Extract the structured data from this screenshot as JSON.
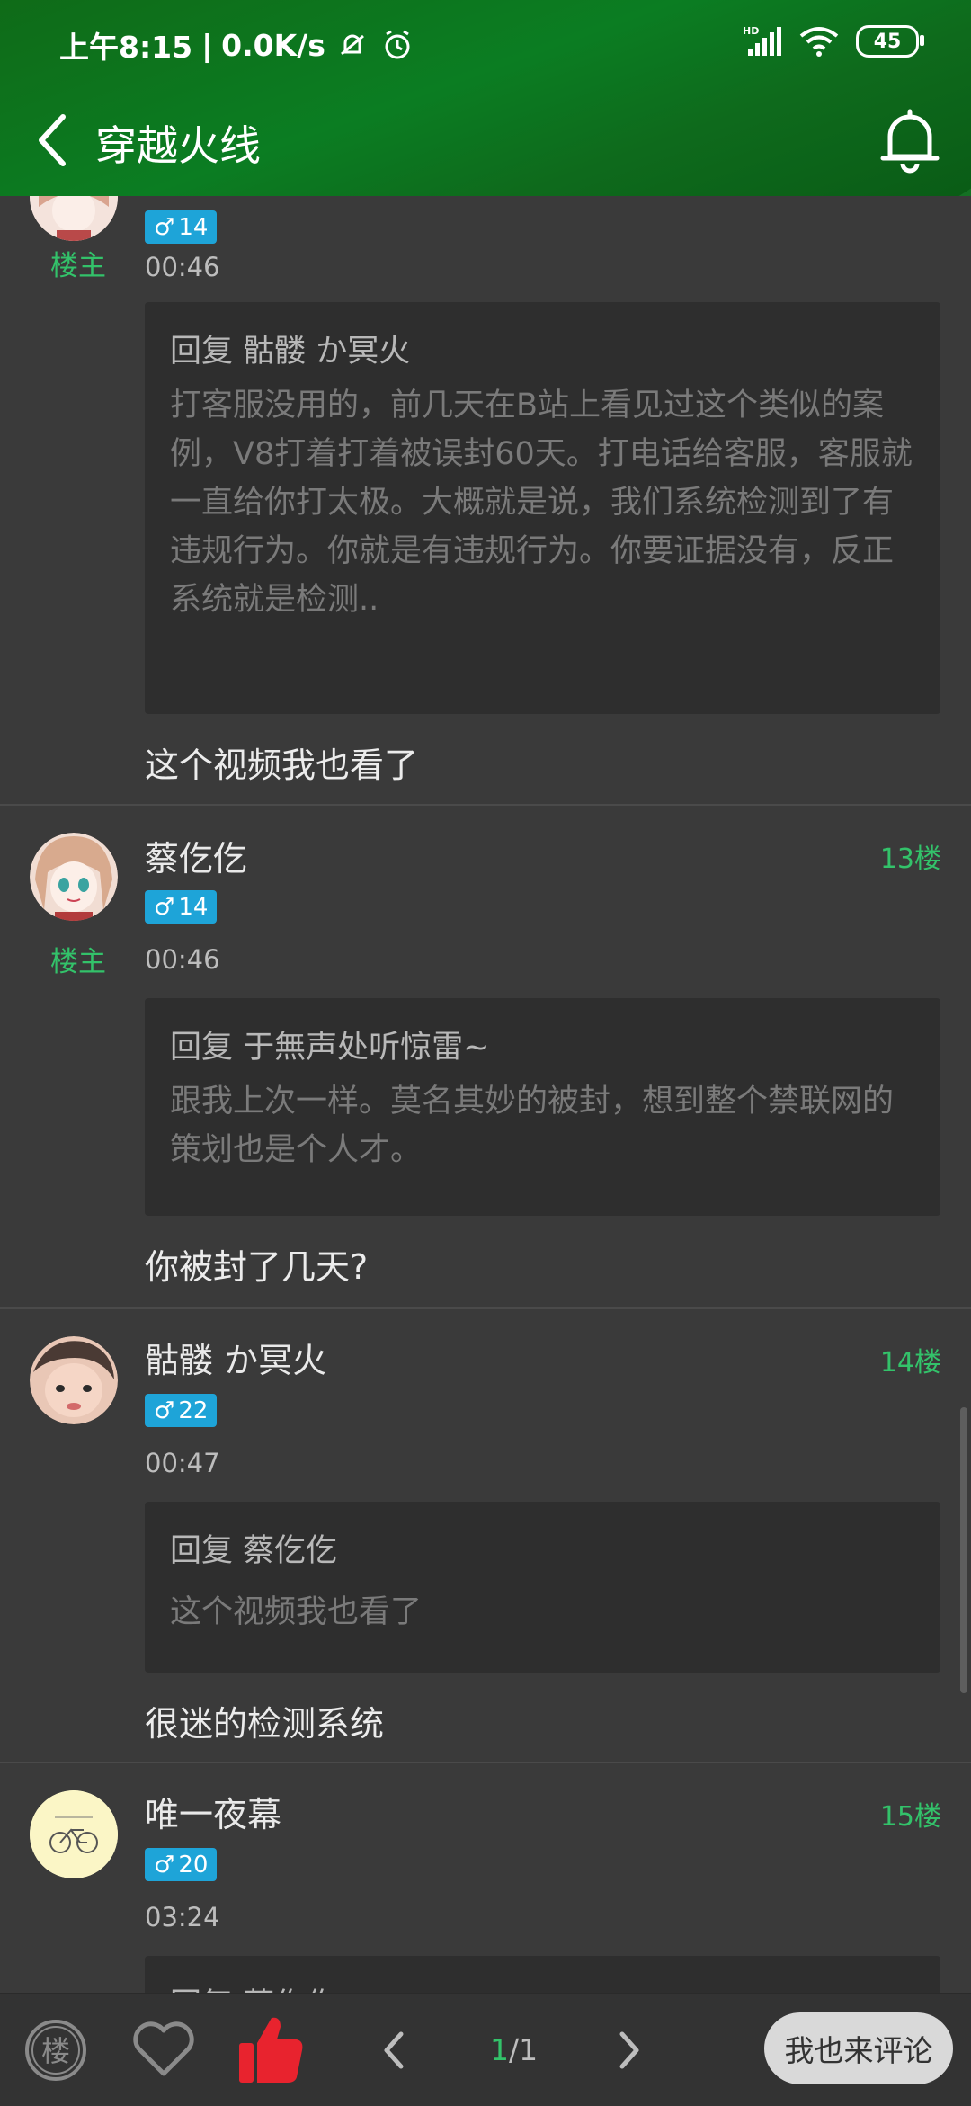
{
  "status_bar": {
    "time": "上午8:15",
    "speed": "0.0K/s",
    "network": "HD",
    "battery": "45"
  },
  "nav": {
    "title": "穿越火线"
  },
  "colors": {
    "accent_green": "#33c26a",
    "level_blue": "#1ea4d8",
    "header_green": "#0b7d22"
  },
  "posts": [
    {
      "level": "14",
      "owner_tag": "楼主",
      "time": "00:46",
      "quote_head": "回复 骷髅 か冥火",
      "quote_body": "打客服没用的，前几天在B站上看见过这个类似的案例，V8打着打着被误封60天。打电话给客服，客服就一直给你打太极。大概就是说，我们系统检测到了有违规行为。你就是有违规行为。你要证据没有，反正系统就是检测..",
      "reply": "这个视频我也看了"
    },
    {
      "username": "蔡仡仡",
      "floor": "13楼",
      "level": "14",
      "owner_tag": "楼主",
      "time": "00:46",
      "quote_head": "回复 于無声处听惊雷~",
      "quote_body": "跟我上次一样。莫名其妙的被封，想到整个禁联网的策划也是个人才。",
      "reply": "你被封了几天?"
    },
    {
      "username": "骷髅 か冥火",
      "floor": "14楼",
      "level": "22",
      "time": "00:47",
      "quote_head": "回复 蔡仡仡",
      "quote_body": "这个视频我也看了",
      "reply": "很迷的检测系统"
    },
    {
      "username": "唯一夜幕",
      "floor": "15楼",
      "level": "20",
      "time": "03:24",
      "quote_head": "回复 蔡仡仡"
    }
  ],
  "bottom_bar": {
    "floor_icon_label": "楼",
    "page_current": "1",
    "page_total": "/1",
    "comment_button": "我也来评论"
  }
}
